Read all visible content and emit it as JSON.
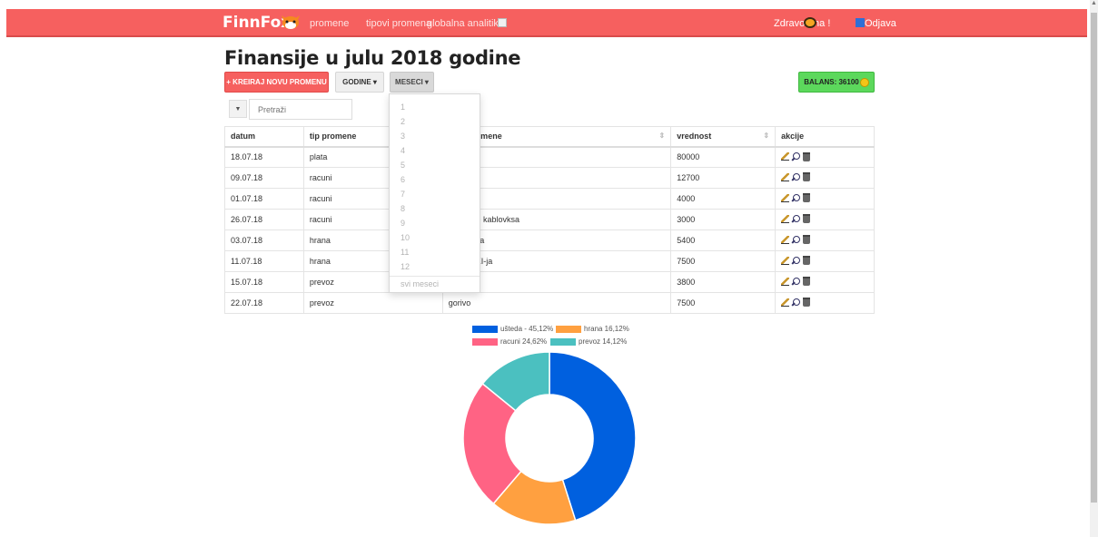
{
  "header": {
    "brand": "FinnFox",
    "nav": [
      "promene",
      "tipovi promena",
      "globalna analitika"
    ],
    "greeting": "Zdravo Ana !",
    "logout": "Odjava",
    "bg_color": "#f6605f"
  },
  "page": {
    "title": "Finansije u julu 2018 godine",
    "create_button": "+ KREIRAJ NOVU PROMENU",
    "years_button": "GODINE ▾",
    "months_button": "MESECI ▾",
    "balance_label": "BALANS: 36100",
    "search_placeholder": "Pretraži"
  },
  "months_dropdown": {
    "items": [
      "1",
      "2",
      "3",
      "4",
      "5",
      "6",
      "7",
      "8",
      "9",
      "10",
      "11",
      "12"
    ],
    "all": "svi meseci"
  },
  "table": {
    "headers": [
      "datum",
      "tip promene",
      "opis promene",
      "vrednost",
      "akcije"
    ],
    "rows": [
      [
        "18.07.18",
        "plata",
        "",
        "80000"
      ],
      [
        "09.07.18",
        "racuni",
        "",
        "12700"
      ],
      [
        "01.07.18",
        "racuni",
        "",
        "4000"
      ],
      [
        "26.07.18",
        "racuni",
        "nternet + kablovksa",
        "3000"
      ],
      [
        "03.07.18",
        "hrana",
        "e iz DIS-a",
        "5400"
      ],
      [
        "11.07.18",
        "hrana",
        "e iz MAXI-ja",
        "7500"
      ],
      [
        "15.07.18",
        "prevoz",
        "",
        "3800"
      ],
      [
        "22.07.18",
        "prevoz",
        "gorivo",
        "7500"
      ]
    ]
  },
  "chart_data": {
    "type": "pie",
    "legend": [
      {
        "label": "ušteda - 45,12%",
        "color": "#0060df"
      },
      {
        "label": "hrana 16,12%",
        "color": "#ffa040"
      },
      {
        "label": "racuni 24,62%",
        "color": "#ff6384"
      },
      {
        "label": "prevoz 14,12%",
        "color": "#4bc0c0"
      }
    ],
    "values": [
      45.12,
      16.12,
      24.62,
      14.12
    ]
  }
}
